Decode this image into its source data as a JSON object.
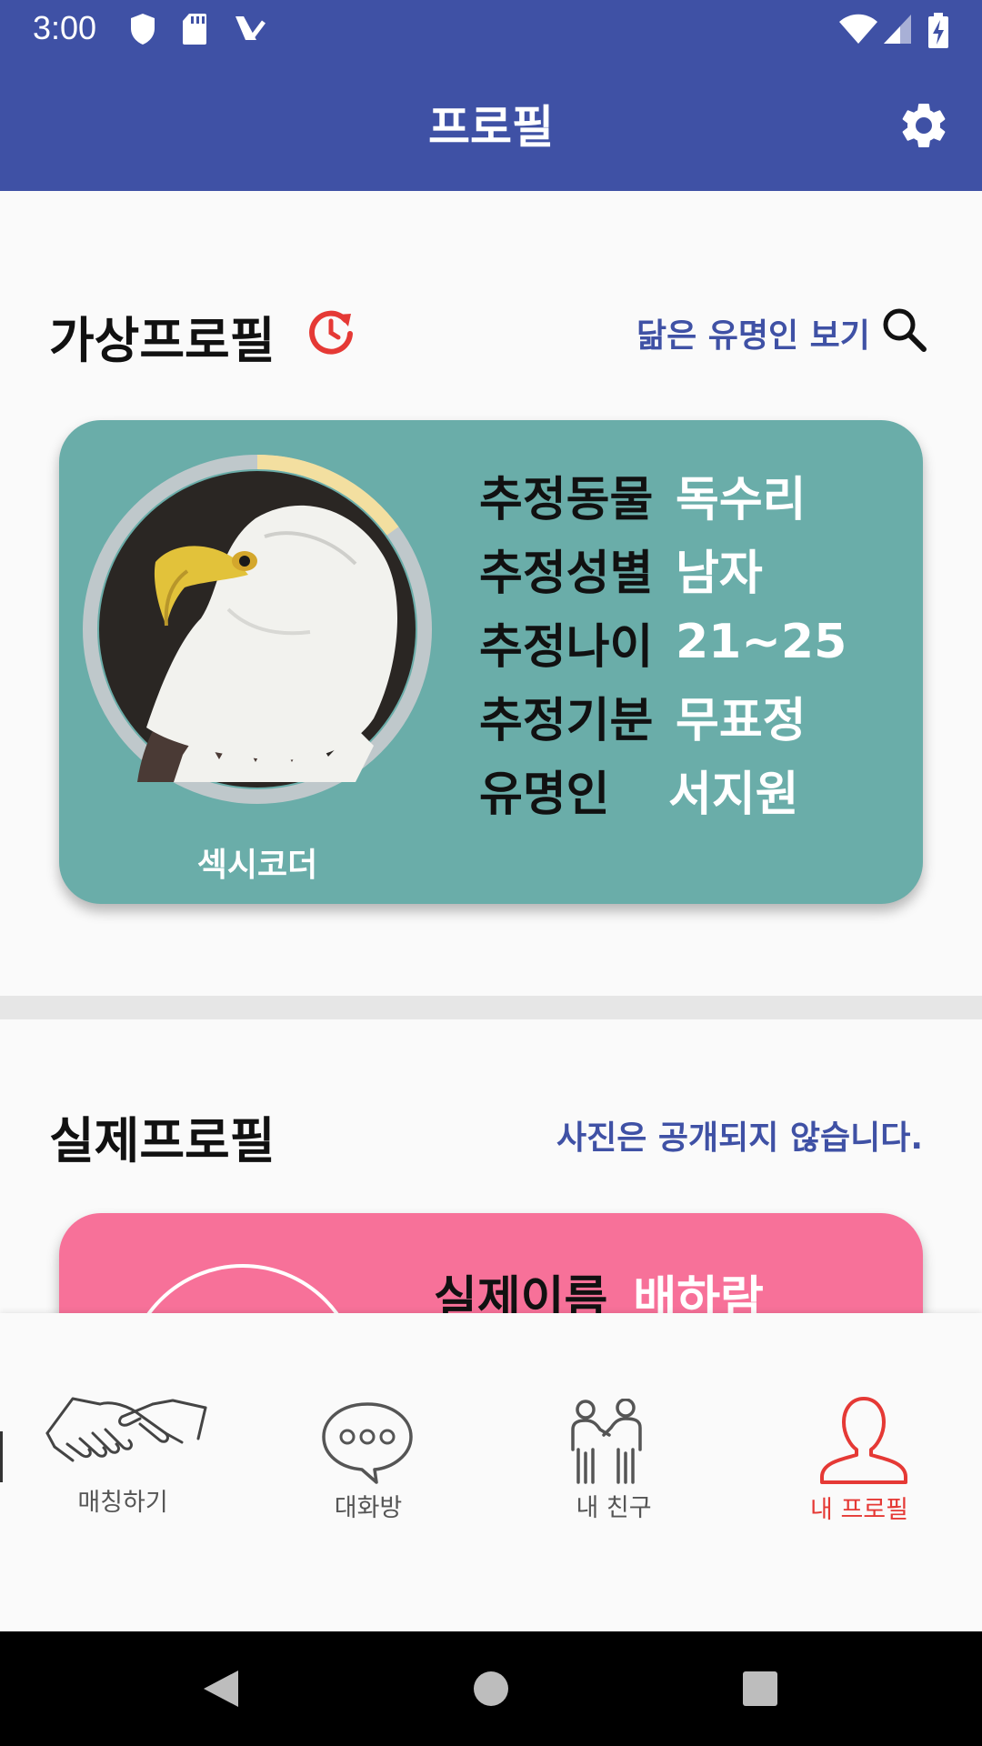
{
  "status_bar": {
    "time": "3:00"
  },
  "app_bar": {
    "title": "프로필"
  },
  "virtual_profile": {
    "section_title": "가상프로필",
    "celebrity_link": "닮은 유명인 보기",
    "nickname": "섹시코더",
    "rows": [
      {
        "label": "추정동물",
        "value": "독수리"
      },
      {
        "label": "추정성별",
        "value": "남자"
      },
      {
        "label": "추정나이",
        "value": "21~25"
      },
      {
        "label": "추정기분",
        "value": "무표정"
      },
      {
        "label": "유명인",
        "value": "서지원"
      }
    ],
    "ring_progress": 0.15
  },
  "real_profile": {
    "section_title": "실제프로필",
    "note": "사진은 공개되지 않습니다.",
    "name_label": "실제이름",
    "name_value": "배하람"
  },
  "bottom_nav": [
    {
      "label": "매칭하기",
      "icon": "handshake-icon",
      "active": false
    },
    {
      "label": "대화방",
      "icon": "chat-bubble-icon",
      "active": false
    },
    {
      "label": "내 친구",
      "icon": "friends-icon",
      "active": false
    },
    {
      "label": "내 프로필",
      "icon": "person-icon",
      "active": true
    }
  ],
  "colors": {
    "primary": "#3F51A5",
    "teal_card": "#6AADA9",
    "pink_card": "#F77199",
    "accent_red": "#E53935"
  }
}
